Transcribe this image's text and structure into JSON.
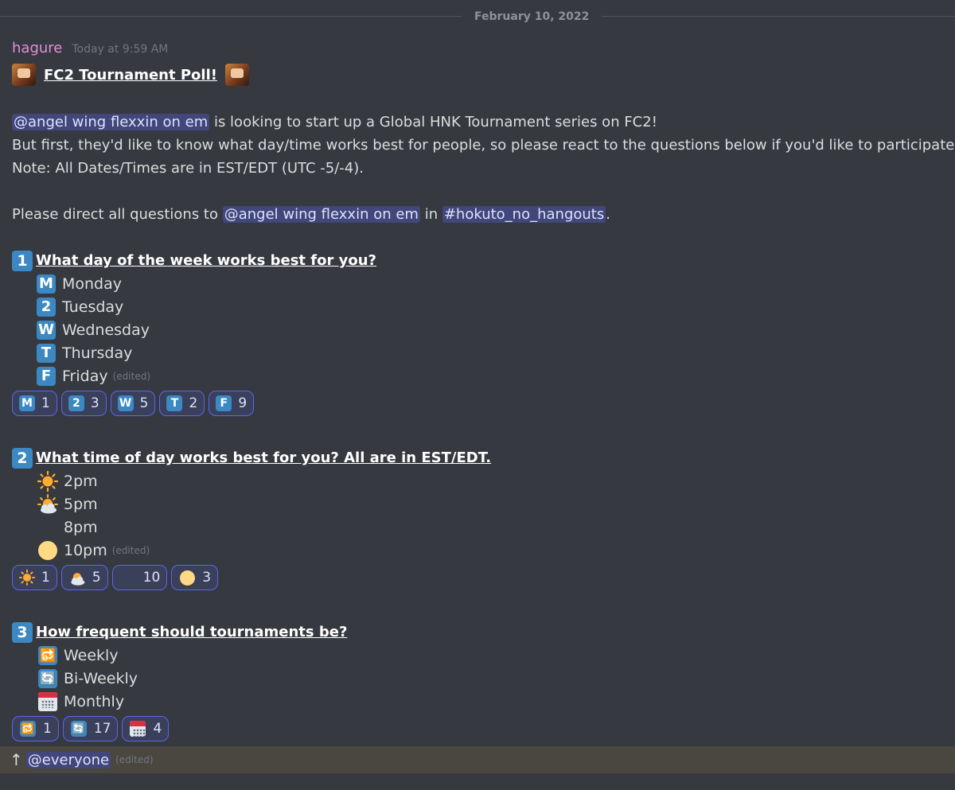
{
  "divider": {
    "date": "February 10, 2022"
  },
  "message": {
    "author": "hagure",
    "timestamp": "Today at 9:59 AM",
    "title": "FC2 Tournament Poll!",
    "mention_user": "@angel wing flexxin on em",
    "intro_rest": " is looking to start up a Global HNK Tournament series on FC2!",
    "line2": "But first, they'd like to know what day/time works best for people, so please react to the questions below if you'd like to participate!",
    "line3": "Note: All Dates/Times are in EST/EDT (UTC -5/-4).",
    "direct_pre": "Please direct all questions to ",
    "direct_in": " in ",
    "channel": "#hokuto_no_hangouts",
    "direct_post": ".",
    "edited_label": "(edited)"
  },
  "q1": {
    "num": "1",
    "title": "What day of the week works best for you?",
    "options": [
      {
        "key": "M",
        "label": "Monday"
      },
      {
        "key": "2",
        "label": "Tuesday"
      },
      {
        "key": "W",
        "label": "Wednesday"
      },
      {
        "key": "T",
        "label": "Thursday"
      },
      {
        "key": "F",
        "label": "Friday"
      }
    ],
    "reactions": [
      {
        "key": "M",
        "count": "1"
      },
      {
        "key": "2",
        "count": "3"
      },
      {
        "key": "W",
        "count": "5"
      },
      {
        "key": "T",
        "count": "2"
      },
      {
        "key": "F",
        "count": "9"
      }
    ]
  },
  "q2": {
    "num": "2",
    "title": "What time of day works best for you? All are in EST/EDT.",
    "options": [
      {
        "icon": "sun-icon",
        "label": "2pm"
      },
      {
        "icon": "sun-behind-cloud-icon",
        "label": "5pm"
      },
      {
        "icon": "crescent-moon-icon",
        "label": "8pm"
      },
      {
        "icon": "full-moon-icon",
        "label": "10pm"
      }
    ],
    "reactions": [
      {
        "icon": "sun-icon",
        "count": "1"
      },
      {
        "icon": "sun-behind-cloud-icon",
        "count": "5"
      },
      {
        "icon": "crescent-moon-icon",
        "count": "10"
      },
      {
        "icon": "full-moon-icon",
        "count": "3"
      }
    ]
  },
  "q3": {
    "num": "3",
    "title": "How frequent should tournaments be?",
    "options": [
      {
        "icon": "repeat-one-icon",
        "glyph": "🔂",
        "label": "Weekly"
      },
      {
        "icon": "repeat-icon",
        "glyph": "🔄",
        "label": "Bi-Weekly"
      },
      {
        "icon": "calendar-icon",
        "label": "Monthly"
      }
    ],
    "reactions": [
      {
        "icon": "repeat-one-icon",
        "count": "1"
      },
      {
        "icon": "repeat-icon",
        "count": "17"
      },
      {
        "icon": "calendar-icon",
        "count": "4"
      }
    ]
  },
  "footer": {
    "arrow": "↑",
    "mention": "@everyone"
  },
  "colors": {
    "background": "#36393f",
    "mention_bg": "#41477a",
    "keycap_blue": "#3b88c3",
    "reaction_border": "#5865f2",
    "author": "#e28fd8",
    "highlight": "#4a4740"
  }
}
